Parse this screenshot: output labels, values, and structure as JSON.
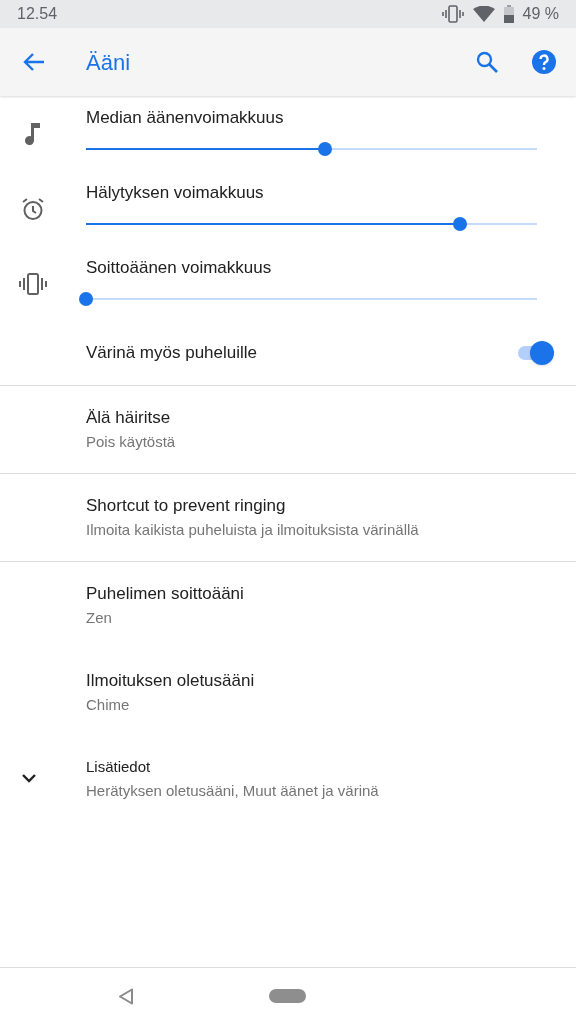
{
  "status_bar": {
    "time": "12.54",
    "battery": "49 %"
  },
  "app_bar": {
    "title": "Ääni"
  },
  "sections": [
    {
      "items": [
        {
          "kind": "slider",
          "title": "Median äänenvoimakkuus",
          "level": 0.53
        },
        {
          "kind": "slider",
          "title": "Hälytyksen voimakkuus",
          "level": 0.83
        },
        {
          "kind": "slider",
          "title": "Soittoäänen voimakkuus",
          "level": 0
        },
        {
          "kind": "switch",
          "title": "Värinä myös puheluille",
          "on": true
        }
      ]
    },
    {
      "items": [
        {
          "kind": "entry",
          "title": "Älä häiritse",
          "subtitle": "Pois käytöstä"
        }
      ]
    },
    {
      "items": [
        {
          "kind": "entry",
          "title": "Shortcut to prevent ringing",
          "subtitle": "Ilmoita kaikista puheluista ja ilmoituksista värinällä"
        }
      ]
    },
    {
      "items": [
        {
          "kind": "entry",
          "title": "Puhelimen soittoääni",
          "subtitle": "Zen"
        },
        {
          "kind": "entry",
          "title": "Ilmoituksen oletusääni",
          "subtitle": "Chime"
        },
        {
          "kind": "expander",
          "title": "Lisätiedot",
          "subtitle": "Herätyksen oletusääni, Muut äänet ja värinä",
          "expanded": false
        }
      ]
    }
  ]
}
